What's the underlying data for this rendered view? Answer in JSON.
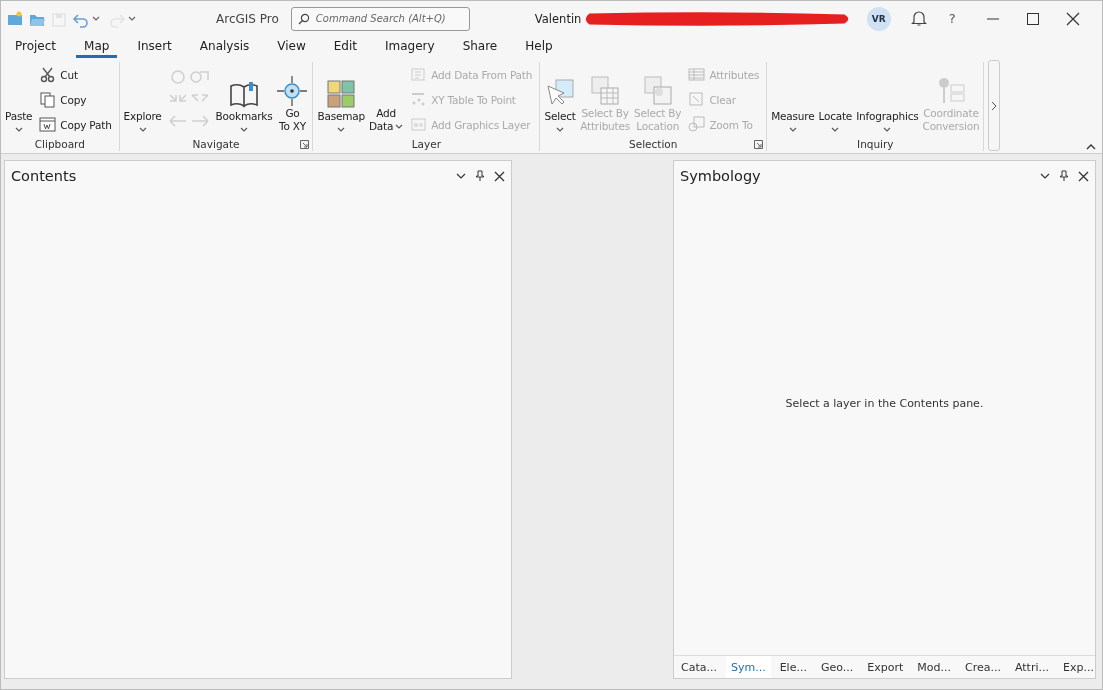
{
  "title_bar": {
    "title": "ArcGIS Pro",
    "search": {
      "placeholder": "Command Search (Alt+Q)"
    },
    "user": "Valentin",
    "avatar": "VR",
    "help": "?"
  },
  "quick_access": [
    {
      "disabled": false
    },
    {
      "disabled": false
    },
    {
      "disabled": true
    },
    {
      "disabled": false
    },
    {
      "disabled": true
    }
  ],
  "tabs": [
    {
      "label": "Project",
      "selected": false
    },
    {
      "label": "Map",
      "selected": true
    },
    {
      "label": "Insert",
      "selected": false
    },
    {
      "label": "Analysis",
      "selected": false
    },
    {
      "label": "View",
      "selected": false
    },
    {
      "label": "Edit",
      "selected": false
    },
    {
      "label": "Imagery",
      "selected": false
    },
    {
      "label": "Share",
      "selected": false
    },
    {
      "label": "Help",
      "selected": false
    }
  ],
  "ribbon": {
    "groups": [
      {
        "label": "Clipboard",
        "launcher": false,
        "columns": [
          {
            "kind": "large",
            "lines": [
              "Paste"
            ],
            "disabled": false,
            "dropdown": true
          },
          {
            "kind": "stack",
            "items": [
              {
                "label": "Cut",
                "disabled": false
              },
              {
                "label": "Copy",
                "disabled": false
              },
              {
                "label": "Copy Path",
                "disabled": false
              }
            ]
          }
        ]
      },
      {
        "label": "Navigate",
        "launcher": true,
        "columns": [
          {
            "kind": "large",
            "lines": [
              "Explore"
            ],
            "disabled": false,
            "dropdown": true
          },
          {
            "kind": "nav",
            "disabled": true
          },
          {
            "kind": "large",
            "lines": [
              "Bookmarks"
            ],
            "disabled": false,
            "dropdown": true
          },
          {
            "kind": "large",
            "lines": [
              "Go",
              "To XY"
            ],
            "disabled": false
          }
        ]
      },
      {
        "label": "Layer",
        "launcher": false,
        "columns": [
          {
            "kind": "large",
            "lines": [
              "Basemap"
            ],
            "disabled": false,
            "dropdown": true
          },
          {
            "kind": "large",
            "lines": [
              "Add",
              "Data"
            ],
            "disabled": false,
            "dropdown": true
          },
          {
            "kind": "stack",
            "items": [
              {
                "label": "Add Data From Path",
                "disabled": true
              },
              {
                "label": "XY Table To Point",
                "disabled": true
              },
              {
                "label": "Add Graphics Layer",
                "disabled": true
              }
            ]
          }
        ]
      },
      {
        "label": "Selection",
        "launcher": true,
        "columns": [
          {
            "kind": "large",
            "lines": [
              "Select"
            ],
            "disabled": false,
            "dropdown": true
          },
          {
            "kind": "large",
            "lines": [
              "Select By",
              "Attributes"
            ],
            "disabled": true
          },
          {
            "kind": "large",
            "lines": [
              "Select By",
              "Location"
            ],
            "disabled": true
          },
          {
            "kind": "stack",
            "items": [
              {
                "label": "Attributes",
                "disabled": true
              },
              {
                "label": "Clear",
                "disabled": true
              },
              {
                "label": "Zoom To",
                "disabled": true
              }
            ]
          }
        ]
      },
      {
        "label": "Inquiry",
        "launcher": false,
        "columns": [
          {
            "kind": "large",
            "lines": [
              "Measure"
            ],
            "disabled": false,
            "dropdown": true
          },
          {
            "kind": "large",
            "lines": [
              "Locate"
            ],
            "disabled": false,
            "dropdown": true
          },
          {
            "kind": "large",
            "lines": [
              "Infographics"
            ],
            "disabled": false,
            "dropdown": true
          },
          {
            "kind": "large",
            "lines": [
              "Coordinate",
              "Conversion"
            ],
            "disabled": true
          }
        ]
      }
    ]
  },
  "contents_pane": {
    "title": "Contents"
  },
  "symbology_pane": {
    "title": "Symbology",
    "message": "Select a layer in the Contents pane.",
    "tabs": [
      {
        "label": "Cata...",
        "selected": false
      },
      {
        "label": "Sym...",
        "selected": true
      },
      {
        "label": "Ele...",
        "selected": false
      },
      {
        "label": "Geo...",
        "selected": false
      },
      {
        "label": "Export",
        "selected": false
      },
      {
        "label": "Mod...",
        "selected": false
      },
      {
        "label": "Crea...",
        "selected": false
      },
      {
        "label": "Attri...",
        "selected": false
      },
      {
        "label": "Exp...",
        "selected": false
      }
    ]
  }
}
